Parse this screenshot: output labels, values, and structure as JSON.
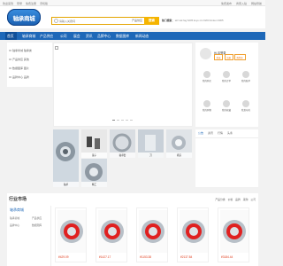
{
  "topbar": {
    "left": [
      "欢迎来到",
      "登录",
      "免费注册",
      "手机版"
    ],
    "right": [
      "免费发布",
      "商家入驻",
      "网站导航"
    ]
  },
  "header": {
    "logo": "轴承商城",
    "search_placeholder": "请输入关键词",
    "search_category": "产品供应",
    "search_button": "搜索",
    "hot_label": "热门搜索：",
    "hot_words": "skf nsk fag 6205 koyo ntn 6203 timken 6305"
  },
  "nav": {
    "items": [
      "首页",
      "轴承商城",
      "产品供应",
      "公司",
      "展会",
      "资讯",
      "品牌中心",
      "数据图库",
      "新闻动态"
    ]
  },
  "cats": {
    "items": [
      "轴承商城 轴承类",
      "产品供应 其他",
      "数据图库 图片",
      "品牌中心 品牌"
    ]
  },
  "user": {
    "greeting": "Hi,请登录",
    "login": "登录",
    "register": "注册",
    "cart": "购物车",
    "quick": [
      {
        "label": "我的购买"
      },
      {
        "label": "我的订单"
      },
      {
        "label": "我的账单"
      },
      {
        "label": "我的购物"
      },
      {
        "label": "我的收藏"
      },
      {
        "label": "我发布的"
      }
    ]
  },
  "tabs": {
    "items": [
      "公告",
      "资讯",
      "行情",
      "头条"
    ]
  },
  "strip": {
    "labels": [
      "轴承",
      "滚子",
      "轴承套",
      "刀",
      "机床",
      "精工"
    ]
  },
  "section": {
    "title": "行业市场",
    "links": [
      "产品分类",
      "价格",
      "品牌",
      "采购",
      "公司"
    ],
    "side_title": "轴承商城",
    "side_items": [
      "轴承商城",
      "产品供应",
      "品牌中心",
      "数据图库"
    ],
    "prices": [
      "¥429.09",
      "¥1427.17",
      "¥1153.38",
      "¥2137.84",
      "¥3184.44"
    ]
  }
}
